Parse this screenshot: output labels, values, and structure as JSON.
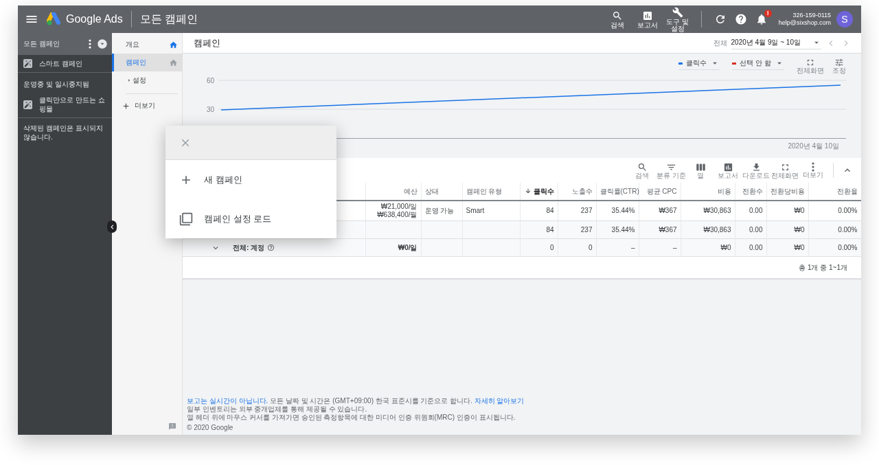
{
  "header": {
    "app_name": "Google Ads",
    "page_title": "모든 캠페인",
    "tools": [
      "검색",
      "보고서",
      "도구 및 설정"
    ],
    "notification_badge": "!",
    "account": {
      "phone": "326-159-0115",
      "email": "help@sixshop.com",
      "avatar": "S"
    }
  },
  "sidebar": {
    "title": "모든 캠페인",
    "items": [
      {
        "kind": "campaign",
        "label": "스마트 캠페인"
      },
      {
        "kind": "heading",
        "label": "운영중 및 일시중지됨"
      },
      {
        "kind": "campaign",
        "label": "클릭만으로 만드는 쇼핑몰"
      },
      {
        "kind": "note",
        "label": "삭제된 캠페인은 표시되지 않습니다."
      }
    ]
  },
  "nav": [
    {
      "kind": "page",
      "label": "개요",
      "is_home": true,
      "selected": false
    },
    {
      "kind": "page",
      "label": "캠페인",
      "is_home": false,
      "selected": true
    },
    {
      "kind": "group",
      "label": "설정",
      "selected": false
    },
    {
      "kind": "more",
      "label": "더보기",
      "selected": false
    }
  ],
  "main": {
    "title": "캠페인",
    "date": {
      "label": "전체",
      "range": "2020년 4월 9일 ~ 10일"
    },
    "chart": {
      "legend": [
        {
          "label": "클릭수",
          "color": "#1a73e8"
        },
        {
          "label": "선택 안 함",
          "color": "#d93025"
        }
      ],
      "actions": [
        "전체화면",
        "조정"
      ],
      "y_labels": [
        "60",
        "30"
      ],
      "end_date": "2020년 4월 10일"
    },
    "table": {
      "toolbar": [
        "검색",
        "분류 기준",
        "열",
        "보고서",
        "다운로드",
        "전체화면",
        "더보기"
      ],
      "columns": [
        null,
        {
          "label": "예산",
          "sorted": false
        },
        {
          "label": "상태",
          "sorted": false
        },
        {
          "label": "캠페인 유형",
          "sorted": false
        },
        {
          "label": "클릭수",
          "sorted": true
        },
        {
          "label": "노출수",
          "sorted": false
        },
        {
          "label": "클릭률(CTR)",
          "sorted": false
        },
        {
          "label": "평균 CPC",
          "sorted": false
        },
        {
          "label": "비용",
          "sorted": false
        },
        {
          "label": "전환수",
          "sorted": false
        },
        {
          "label": "전환당비용",
          "sorted": false
        },
        {
          "label": "전환율",
          "sorted": false
        }
      ],
      "rows": [
        {
          "kind": "campaign",
          "cells": [
            "",
            [
              "₩21,000/일",
              "₩638,400/월"
            ],
            "운영 가능",
            "Smart",
            "84",
            "237",
            "35.44%",
            "₩367",
            "₩30,863",
            "0.00",
            "₩0",
            "0.00%"
          ]
        },
        {
          "kind": "total",
          "cells": [
            "",
            "",
            "",
            "",
            "84",
            "237",
            "35.44%",
            "₩367",
            "₩30,863",
            "0.00",
            "₩0",
            "0.00%"
          ]
        },
        {
          "kind": "account",
          "cells": [
            "전체: 계정",
            "₩0/일",
            "",
            "",
            "0",
            "0",
            "–",
            "–",
            "₩0",
            "0.00",
            "₩0",
            "0.00%"
          ]
        }
      ],
      "pagination": "총 1개 중 1~1개"
    },
    "footer": {
      "notice": [
        {
          "text": "보고는 실시간이 아닙니다.",
          "link": true
        },
        {
          "text": "모든 날짜 및 시간은 (GMT+09:00) 한국 표준시를 기준으로 합니다.",
          "link": false
        },
        {
          "text": "자세히 알아보기",
          "link": true
        }
      ],
      "lines": [
        "일부 인벤토리는 외부 중개업체를 통해 제공될 수 있습니다.",
        "열 헤더 위에 마우스 커서를 가져가면 승인된 측정항목에 대한 미디어 인증 위원회(MRC) 인증이 표시됩니다."
      ],
      "copyright": "© 2020 Google"
    }
  },
  "popup": {
    "items": [
      "새 캠페인",
      "캠페인 설정 로드"
    ]
  }
}
